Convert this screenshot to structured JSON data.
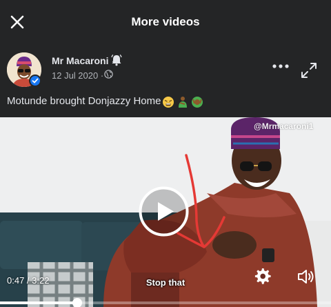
{
  "header": {
    "title": "More videos",
    "close_icon": "close-icon"
  },
  "post": {
    "author": "Mr Macaroni",
    "separator": "·",
    "date": "12 Jul 2020",
    "date_separator": "·",
    "caption": "Motunde brought Donjazzy Home",
    "icons": [
      "bell-icon",
      "globe-icon",
      "more-options-icon",
      "expand-icon"
    ]
  },
  "video": {
    "watermark": "@Mrmacaroni1",
    "subtitle": "Stop that",
    "current_time": "0:47",
    "duration": "3:22",
    "time_display": "0:47 / 3:22",
    "progress": 0.233,
    "icons": [
      "play-icon",
      "settings-icon",
      "volume-icon"
    ]
  },
  "colors": {
    "background": "#242526",
    "text": "#e4e6eb",
    "secondary_text": "#b0b3b8",
    "verified_badge": "#1877f2",
    "annotation": "#e53935"
  }
}
